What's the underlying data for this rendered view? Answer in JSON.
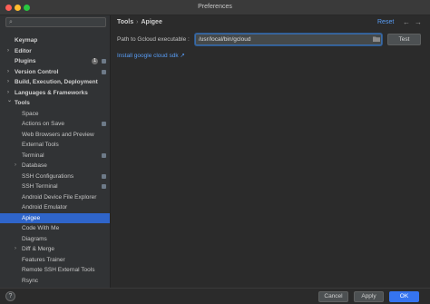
{
  "window": {
    "title": "Preferences"
  },
  "search": {
    "placeholder": ""
  },
  "sidebar": {
    "items": [
      {
        "label": "Keymap",
        "level": 0,
        "bold": true,
        "arrow": false
      },
      {
        "label": "Editor",
        "level": 0,
        "bold": true,
        "arrow": true
      },
      {
        "label": "Plugins",
        "level": 0,
        "bold": true,
        "arrow": false,
        "badge": "1",
        "square": true
      },
      {
        "label": "Version Control",
        "level": 0,
        "bold": true,
        "arrow": true,
        "square": true
      },
      {
        "label": "Build, Execution, Deployment",
        "level": 0,
        "bold": true,
        "arrow": true
      },
      {
        "label": "Languages & Frameworks",
        "level": 0,
        "bold": true,
        "arrow": true
      },
      {
        "label": "Tools",
        "level": 0,
        "bold": true,
        "arrow": true,
        "expanded": true
      },
      {
        "label": "Space",
        "level": 1
      },
      {
        "label": "Actions on Save",
        "level": 1,
        "square": true
      },
      {
        "label": "Web Browsers and Preview",
        "level": 1
      },
      {
        "label": "External Tools",
        "level": 1
      },
      {
        "label": "Terminal",
        "level": 1,
        "square": true
      },
      {
        "label": "Database",
        "level": 1,
        "arrow": true
      },
      {
        "label": "SSH Configurations",
        "level": 1,
        "square": true
      },
      {
        "label": "SSH Terminal",
        "level": 1,
        "square": true
      },
      {
        "label": "Android Device File Explorer",
        "level": 1
      },
      {
        "label": "Android Emulator",
        "level": 1
      },
      {
        "label": "Apigee",
        "level": 1,
        "selected": true
      },
      {
        "label": "Code With Me",
        "level": 1
      },
      {
        "label": "Diagrams",
        "level": 1
      },
      {
        "label": "Diff & Merge",
        "level": 1,
        "arrow": true
      },
      {
        "label": "Features Trainer",
        "level": 1
      },
      {
        "label": "Remote SSH External Tools",
        "level": 1
      },
      {
        "label": "Rsync",
        "level": 1
      }
    ]
  },
  "main": {
    "breadcrumb": [
      "Tools",
      "Apigee"
    ],
    "reset_label": "Reset",
    "path_label": "Path to Gcloud executable :",
    "path_value": "/usr/local/bin/gcloud",
    "test_label": "Test",
    "install_link": "Install google cloud sdk ↗"
  },
  "footer": {
    "help_label": "?",
    "cancel_label": "Cancel",
    "apply_label": "Apply",
    "ok_label": "OK"
  },
  "colors": {
    "accent": "#3574f0",
    "selection": "#2f65ca",
    "link": "#589df6"
  },
  "icons": [
    "search-icon",
    "folder-icon",
    "back-arrow-icon",
    "forward-arrow-icon",
    "help-icon"
  ]
}
